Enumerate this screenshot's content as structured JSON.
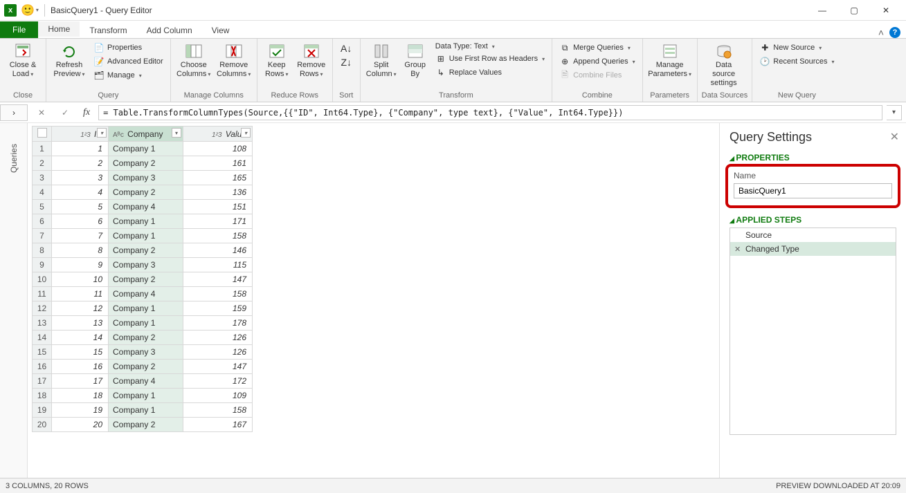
{
  "window": {
    "title": "BasicQuery1 - Query Editor"
  },
  "tabs": {
    "file": "File",
    "home": "Home",
    "transform": "Transform",
    "addcolumn": "Add Column",
    "view": "View"
  },
  "ribbon": {
    "close_load": "Close &\nLoad",
    "close_group": "Close",
    "refresh": "Refresh\nPreview",
    "properties": "Properties",
    "adv_editor": "Advanced Editor",
    "manage": "Manage",
    "query_group": "Query",
    "choose_cols": "Choose\nColumns",
    "remove_cols": "Remove\nColumns",
    "manage_cols_group": "Manage Columns",
    "keep_rows": "Keep\nRows",
    "remove_rows": "Remove\nRows",
    "reduce_rows_group": "Reduce Rows",
    "sort_group": "Sort",
    "split_col": "Split\nColumn",
    "group_by": "Group\nBy",
    "datatype": "Data Type: Text",
    "first_row": "Use First Row as Headers",
    "replace": "Replace Values",
    "transform_group": "Transform",
    "merge": "Merge Queries",
    "append": "Append Queries",
    "combine_files": "Combine Files",
    "combine_group": "Combine",
    "manage_params": "Manage\nParameters",
    "params_group": "Parameters",
    "datasource": "Data source\nsettings",
    "datasources_group": "Data Sources",
    "new_source": "New Source",
    "recent_sources": "Recent Sources",
    "newquery_group": "New Query"
  },
  "formula": "= Table.TransformColumnTypes(Source,{{\"ID\", Int64.Type}, {\"Company\", type text}, {\"Value\", Int64.Type}})",
  "queries_side": "Queries",
  "columns": {
    "id": "ID",
    "company": "Company",
    "value": "Value"
  },
  "rows": [
    {
      "n": 1,
      "id": 1,
      "company": "Company 1",
      "value": 108
    },
    {
      "n": 2,
      "id": 2,
      "company": "Company 2",
      "value": 161
    },
    {
      "n": 3,
      "id": 3,
      "company": "Company 3",
      "value": 165
    },
    {
      "n": 4,
      "id": 4,
      "company": "Company 2",
      "value": 136
    },
    {
      "n": 5,
      "id": 5,
      "company": "Company 4",
      "value": 151
    },
    {
      "n": 6,
      "id": 6,
      "company": "Company 1",
      "value": 171
    },
    {
      "n": 7,
      "id": 7,
      "company": "Company 1",
      "value": 158
    },
    {
      "n": 8,
      "id": 8,
      "company": "Company 2",
      "value": 146
    },
    {
      "n": 9,
      "id": 9,
      "company": "Company 3",
      "value": 115
    },
    {
      "n": 10,
      "id": 10,
      "company": "Company 2",
      "value": 147
    },
    {
      "n": 11,
      "id": 11,
      "company": "Company 4",
      "value": 158
    },
    {
      "n": 12,
      "id": 12,
      "company": "Company 1",
      "value": 159
    },
    {
      "n": 13,
      "id": 13,
      "company": "Company 1",
      "value": 178
    },
    {
      "n": 14,
      "id": 14,
      "company": "Company 2",
      "value": 126
    },
    {
      "n": 15,
      "id": 15,
      "company": "Company 3",
      "value": 126
    },
    {
      "n": 16,
      "id": 16,
      "company": "Company 2",
      "value": 147
    },
    {
      "n": 17,
      "id": 17,
      "company": "Company 4",
      "value": 172
    },
    {
      "n": 18,
      "id": 18,
      "company": "Company 1",
      "value": 109
    },
    {
      "n": 19,
      "id": 19,
      "company": "Company 1",
      "value": 158
    },
    {
      "n": 20,
      "id": 20,
      "company": "Company 2",
      "value": 167
    }
  ],
  "settings": {
    "title": "Query Settings",
    "properties": "PROPERTIES",
    "name_label": "Name",
    "name_value": "BasicQuery1",
    "applied_steps": "APPLIED STEPS",
    "step1": "Source",
    "step2": "Changed Type"
  },
  "status": {
    "left": "3 COLUMNS, 20 ROWS",
    "right": "PREVIEW DOWNLOADED AT 20:09"
  }
}
